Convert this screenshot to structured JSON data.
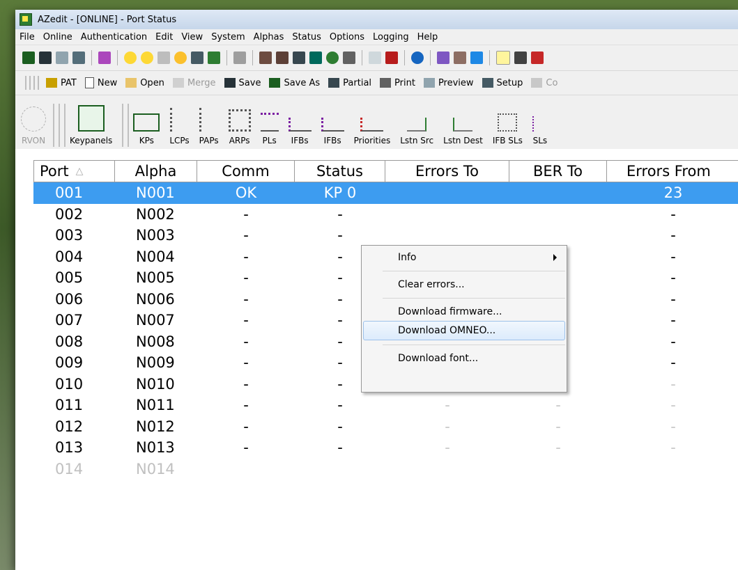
{
  "window": {
    "title": "AZedit - [ONLINE] - Port Status"
  },
  "menu": [
    "File",
    "Online",
    "Authentication",
    "Edit",
    "View",
    "System",
    "Alphas",
    "Status",
    "Options",
    "Logging",
    "Help"
  ],
  "toolbar2": [
    {
      "label": "PAT",
      "icon": "pat-icon",
      "disabled": false
    },
    {
      "label": "New",
      "icon": "new-file-icon",
      "disabled": false
    },
    {
      "label": "Open",
      "icon": "open-folder-icon",
      "disabled": false
    },
    {
      "label": "Merge",
      "icon": "merge-icon",
      "disabled": true
    },
    {
      "label": "Save",
      "icon": "save-icon",
      "disabled": false
    },
    {
      "label": "Save As",
      "icon": "save-as-icon",
      "disabled": false
    },
    {
      "label": "Partial",
      "icon": "partial-save-icon",
      "disabled": false
    },
    {
      "label": "Print",
      "icon": "print-icon",
      "disabled": false
    },
    {
      "label": "Preview",
      "icon": "preview-icon",
      "disabled": false
    },
    {
      "label": "Setup",
      "icon": "print-setup-icon",
      "disabled": false
    },
    {
      "label": "Co",
      "icon": "connect-icon",
      "disabled": true
    }
  ],
  "toolbar3": {
    "rvon": "RVON",
    "keypanels": "Keypanels",
    "buttons": [
      "KPs",
      "LCPs",
      "PAPs",
      "ARPs",
      "PLs",
      "IFBs",
      "IFBs",
      "Priorities",
      "Lstn Src",
      "Lstn Dest",
      "IFB SLs",
      "SLs"
    ]
  },
  "table": {
    "headers": [
      "Port",
      "Alpha",
      "Comm",
      "Status",
      "Errors To",
      "BER To",
      "Errors From"
    ],
    "sort_indicator": "△",
    "rows": [
      [
        "001",
        "N001",
        "OK",
        "KP 0",
        "",
        "",
        "23"
      ],
      [
        "002",
        "N002",
        "-",
        "-",
        "",
        "",
        "-"
      ],
      [
        "003",
        "N003",
        "-",
        "-",
        "",
        "",
        "-"
      ],
      [
        "004",
        "N004",
        "-",
        "-",
        "",
        "",
        "-"
      ],
      [
        "005",
        "N005",
        "-",
        "-",
        "",
        "",
        "-"
      ],
      [
        "006",
        "N006",
        "-",
        "-",
        "",
        "",
        "-"
      ],
      [
        "007",
        "N007",
        "-",
        "-",
        "-",
        "-",
        "-"
      ],
      [
        "008",
        "N008",
        "-",
        "-",
        "-",
        "-",
        "-"
      ],
      [
        "009",
        "N009",
        "-",
        "-",
        "-",
        "-",
        "-"
      ],
      [
        "010",
        "N010",
        "-",
        "-",
        "-",
        "-",
        "-"
      ],
      [
        "011",
        "N011",
        "-",
        "-",
        "-",
        "-",
        "-"
      ],
      [
        "012",
        "N012",
        "-",
        "-",
        "-",
        "-",
        "-"
      ],
      [
        "013",
        "N013",
        "-",
        "-",
        "-",
        "-",
        "-"
      ],
      [
        "014",
        "N014",
        "",
        "",
        "",
        "",
        ""
      ]
    ]
  },
  "context_menu": {
    "items": [
      "Info",
      "Clear errors...",
      "Download firmware...",
      "Download OMNEO...",
      "Download font..."
    ],
    "highlighted": "Download OMNEO..."
  },
  "colors": {
    "selection": "#3d9cf0",
    "menu_highlight": "#dcebfc"
  }
}
